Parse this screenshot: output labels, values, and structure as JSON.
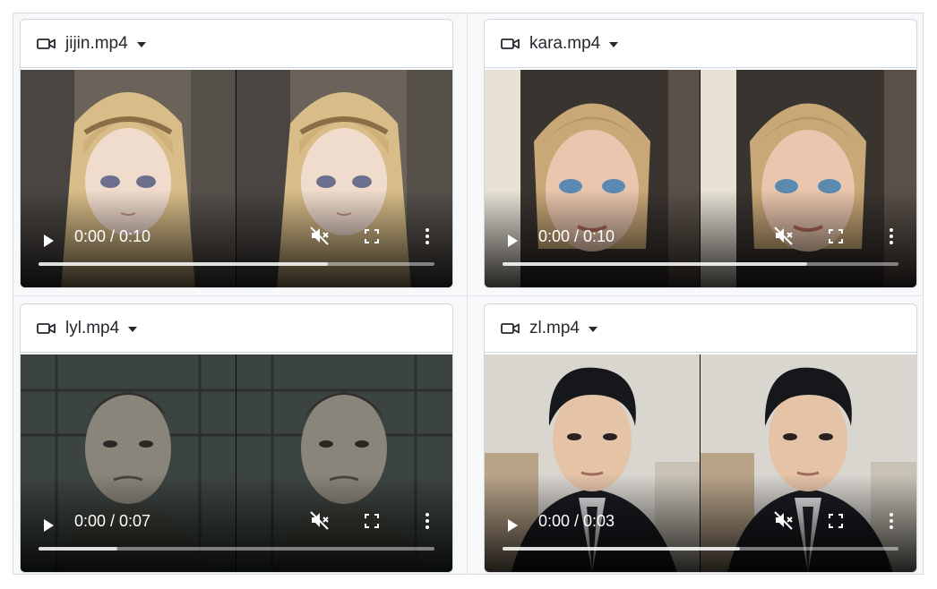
{
  "videos": [
    {
      "file_name": "jijin.mp4",
      "time": "0:00 / 0:10",
      "buffered": 0.73,
      "scene": "anime-girl"
    },
    {
      "file_name": "kara.mp4",
      "time": "0:00 / 0:10",
      "buffered": 0.77,
      "scene": "blonde-woman"
    },
    {
      "file_name": "lyl.mp4",
      "time": "0:00 / 0:07",
      "buffered": 0.2,
      "scene": "older-man"
    },
    {
      "file_name": "zl.mp4",
      "time": "0:00 / 0:03",
      "buffered": 0.6,
      "scene": "young-man-suit"
    }
  ],
  "icons": {
    "file": "video-camera-icon",
    "dropdown": "caret-down-icon",
    "play": "play-icon",
    "mute": "muted-speaker-icon",
    "fullscreen": "fullscreen-icon",
    "menu": "more-vertical-icon"
  },
  "colors": {
    "card_border": "#d0d7de",
    "text": "#24292f",
    "page_bg": "#f6f8fa"
  }
}
